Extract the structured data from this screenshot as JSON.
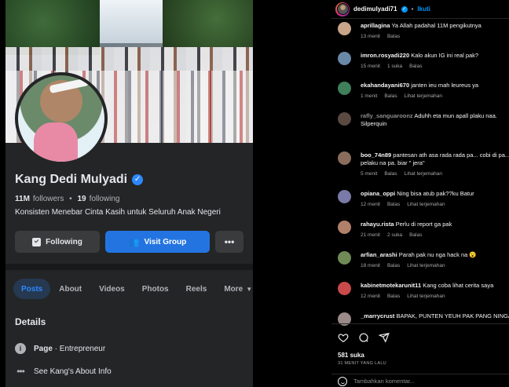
{
  "facebook": {
    "name": "Kang Dedi Mulyadi",
    "followers_count": "11M",
    "followers_label": "followers",
    "following_count": "19",
    "following_label": "following",
    "bio": "Konsisten Menebar Cinta Kasih untuk Seluruh Anak Negeri",
    "buttons": {
      "following": "Following",
      "visit_group": "Visit Group",
      "more": "•••"
    },
    "tabs": [
      {
        "label": "Posts",
        "active": true
      },
      {
        "label": "About"
      },
      {
        "label": "Videos"
      },
      {
        "label": "Photos"
      },
      {
        "label": "Reels"
      },
      {
        "label": "More"
      }
    ],
    "details_title": "Details",
    "details": {
      "page_label": "Page",
      "page_sep": " · ",
      "page_category": "Entrepreneur",
      "about_link": "See Kang's About Info"
    },
    "colors": {
      "background": "#242526",
      "accent": "#2374e1",
      "verified": "#2d88ff"
    }
  },
  "instagram": {
    "header": {
      "username": "dedimulyadi71",
      "dot": "•",
      "follow": "Ikuti"
    },
    "comments": [
      {
        "username": "aprillagina",
        "text": "Ya Allah padahal 11M pengikutnya",
        "time": "13 menit",
        "meta": [
          "Balas"
        ],
        "avatar_color": "#c8a58a"
      },
      {
        "username": "imron.rosyadi220",
        "text": "Kalo akun IG ini real pak?",
        "time": "15 menit",
        "meta": [
          "1 suka",
          "Balas"
        ],
        "avatar_color": "#6a88a8"
      },
      {
        "username": "ekahandayani670",
        "text": "janten ieu mah leureus ya",
        "time": "1 menit",
        "meta": [
          "Balas",
          "Lihat terjemahan"
        ],
        "avatar_color": "#3f7f5a"
      },
      {
        "username": "rafly_sanguaroonz",
        "text": "Aduhh eta mun apall plaku naa. Silperquin",
        "time": "",
        "meta": [],
        "avatar_color": "#5a4a42",
        "faded_name": true,
        "wrap": true
      },
      {
        "username": "boo_74n89",
        "text": "pantesan ath asa rada rada pa... cobi di pa... pelaku na pa. biar \" jera\"",
        "time": "5 menit",
        "meta": [
          "Balas",
          "Lihat terjemahan"
        ],
        "avatar_color": "#8a6d5c",
        "wrap": true
      },
      {
        "username": "opiana_oppi",
        "text": "Ning bisa atub pak??ku Batur",
        "time": "12 menit",
        "meta": [
          "Balas",
          "Lihat terjemahan"
        ],
        "avatar_color": "#7a7aa8"
      },
      {
        "username": "rahayu.rista",
        "text": "Perlu di report ga pak",
        "time": "21 menit",
        "meta": [
          "2 suka",
          "Balas"
        ],
        "avatar_color": "#b0806a"
      },
      {
        "username": "arfian_arashi",
        "text": "Parah pak nu nga hack na 😮",
        "time": "18 menit",
        "meta": [
          "Balas",
          "Lihat terjemahan"
        ],
        "avatar_color": "#6f8a55"
      },
      {
        "username": "kabinetmotekarunit11",
        "text": "Kang coba lihat cerita saya",
        "time": "12 menit",
        "meta": [
          "Balas",
          "Lihat terjemahan"
        ],
        "avatar_color": "#c94a4a"
      },
      {
        "username": "_marrycrust",
        "text": "BAPAK, PUNTEN YEUH PAK PANG NINGA",
        "time": "",
        "meta": [],
        "avatar_color": "#9a8a8a"
      }
    ],
    "likes": "581 suka",
    "time_ago": "31 MENIT YANG LALU",
    "add_comment_placeholder": "Tambahkan komentar...",
    "colors": {
      "link": "#0095f6",
      "text": "#f5f5f5",
      "muted": "#a8a8a8"
    }
  }
}
